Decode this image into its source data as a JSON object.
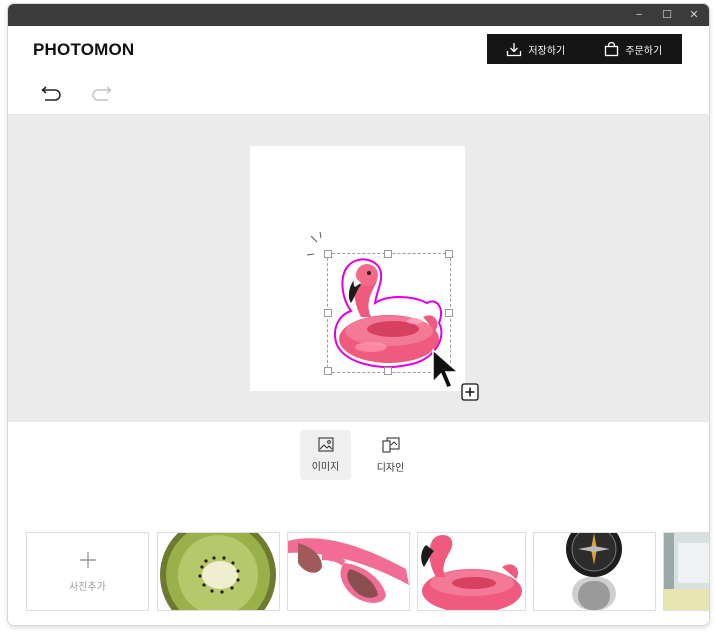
{
  "window": {
    "controls": {
      "minimize": "−",
      "maximize": "☐",
      "close": "✕"
    }
  },
  "header": {
    "logo": "PHOTOMON",
    "save_label": "저장하기",
    "order_label": "주문하기"
  },
  "toolbar": {
    "undo_icon": "undo-icon",
    "redo_icon": "redo-icon"
  },
  "colors": {
    "accent_dark": "#151515",
    "canvas_bg": "#ebebeb",
    "sticker_outline": "#e000e0",
    "flamingo_pink": "#f05878"
  },
  "tabs": [
    {
      "label": "이미지",
      "icon": "image-icon",
      "active": true
    },
    {
      "label": "디자인",
      "icon": "design-icon",
      "active": false
    }
  ],
  "photos": {
    "add_label": "사진추가",
    "items": [
      {
        "name": "kiwi"
      },
      {
        "name": "pink-sunglasses"
      },
      {
        "name": "flamingo-float"
      },
      {
        "name": "compass"
      },
      {
        "name": "partial-photo"
      }
    ]
  }
}
